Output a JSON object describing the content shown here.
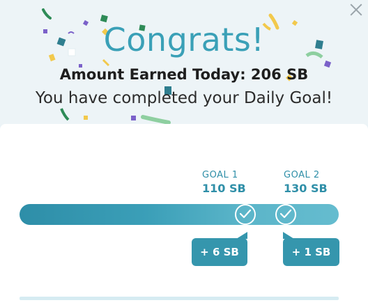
{
  "dialog": {
    "title": "Congrats!",
    "earned_text": "Amount Earned Today: 206 SB",
    "completed_text": "You have completed your Daily Goal!"
  },
  "goals": [
    {
      "label": "GOAL 1",
      "value": "110 SB",
      "bonus": "+ 6 SB"
    },
    {
      "label": "GOAL 2",
      "value": "130 SB",
      "bonus": "+ 1 SB"
    }
  ],
  "colors": {
    "accent": "#3aa0b7",
    "bar_start": "#2e8ea8",
    "bar_end": "#65bccf",
    "badge": "#3596ad",
    "confetti": [
      "#2e8b57",
      "#f2c94c",
      "#7b61c9",
      "#2f7e8f",
      "#8ecfa0"
    ]
  },
  "icons": {
    "close": "close-icon",
    "check": "check-circle-icon"
  }
}
